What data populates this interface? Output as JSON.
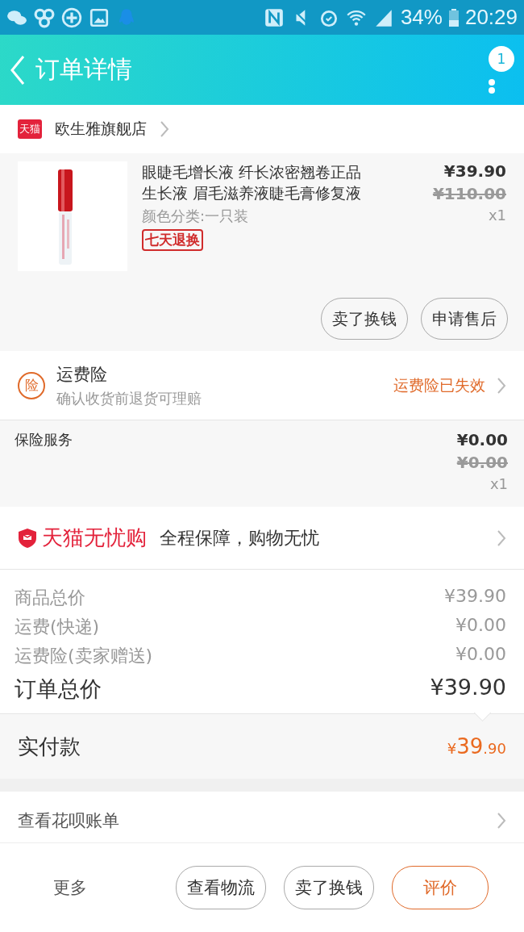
{
  "status_bar": {
    "battery": "34%",
    "time": "20:29"
  },
  "header": {
    "title": "订单详情",
    "badge": "1"
  },
  "shop": {
    "logo": "天猫",
    "name": "欧生雅旗舰店"
  },
  "product": {
    "kind": "picture",
    "title": "眼睫毛增长液 纤长浓密翘卷正品生长液 眉毛滋养液睫毛膏修复液",
    "sku": "颜色分类:一只装",
    "tag": "七天退换",
    "price": "¥39.90",
    "original_price": "¥110.00",
    "quantity": "x1",
    "buttons": [
      "卖了换钱",
      "申请售后"
    ]
  },
  "insurance": {
    "icon_text": "险",
    "title": "运费险",
    "subtitle": "确认收货前退货可理赔",
    "status": "运费险已失效"
  },
  "insurance_service": {
    "label": "保险服务",
    "price": "¥0.00",
    "original_price": "¥0.00",
    "quantity": "x1"
  },
  "guarantee": {
    "brand": "天猫无忧购",
    "text": "全程保障，购物无忧"
  },
  "totals": [
    {
      "kind": "line",
      "label": "商品总价",
      "value": "¥39.90"
    },
    {
      "kind": "line",
      "label": "运费(快递)",
      "value": "¥0.00"
    },
    {
      "kind": "line",
      "label": "运费险(卖家赠送)",
      "value": "¥0.00"
    },
    {
      "kind": "total",
      "label": "订单总价",
      "value": "¥39.90"
    }
  ],
  "paid": {
    "label": "实付款",
    "currency": "¥",
    "integer": "39",
    "decimal": ".90"
  },
  "huabei": {
    "label": "查看花呗账单"
  },
  "bottom_bar": {
    "more": "更多",
    "buttons": [
      {
        "label": "查看物流",
        "primary": false
      },
      {
        "label": "卖了换钱",
        "primary": false
      },
      {
        "label": "评价",
        "primary": true
      }
    ]
  }
}
